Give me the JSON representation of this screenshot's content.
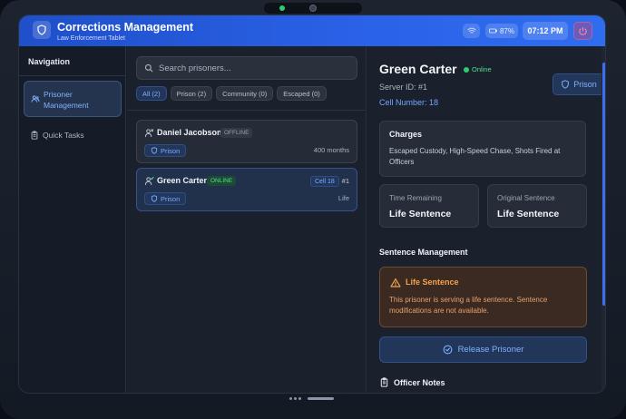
{
  "header": {
    "title": "Corrections Management",
    "subtitle": "Law Enforcement Tablet",
    "battery": "87%",
    "time": "07:12 PM"
  },
  "sidebar": {
    "title": "Navigation",
    "items": [
      {
        "label": "Prisoner Management",
        "icon": "users-icon",
        "active": true
      },
      {
        "label": "Quick Tasks",
        "icon": "clipboard-icon",
        "active": false
      }
    ]
  },
  "list": {
    "search_placeholder": "Search prisoners...",
    "filters": [
      {
        "label": "All (2)",
        "active": true
      },
      {
        "label": "Prison (2)",
        "active": false
      },
      {
        "label": "Community (0)",
        "active": false
      },
      {
        "label": "Escaped (0)",
        "active": false
      }
    ],
    "prisoners": [
      {
        "name": "Daniel Jacobson",
        "status": "OFFLINE",
        "tag": "Prison",
        "sentence": "400 months"
      },
      {
        "name": "Green Carter",
        "status": "ONLINE",
        "tag": "Prison",
        "cell": "Cell 18",
        "id": "#1",
        "sentence": "Life"
      }
    ]
  },
  "detail": {
    "name": "Green Carter",
    "status": "Online",
    "server_id": "Server ID: #1",
    "cell_number": "Cell Number: 18",
    "location_button": "Prison",
    "charges_title": "Charges",
    "charges_text": "Escaped Custody, High-Speed Chase, Shots Fired at Officers",
    "time_remaining_label": "Time Remaining",
    "time_remaining_value": "Life Sentence",
    "original_sentence_label": "Original Sentence",
    "original_sentence_value": "Life Sentence",
    "sentence_mgmt_title": "Sentence Management",
    "warning_title": "Life Sentence",
    "warning_text": "This prisoner is serving a life sentence. Sentence modifications are not available.",
    "release_button": "Release Prisoner",
    "notes_title": "Officer Notes"
  },
  "colors": {
    "accent": "#2f6df0",
    "online": "#2ecc71",
    "warning": "#f2a24b"
  }
}
